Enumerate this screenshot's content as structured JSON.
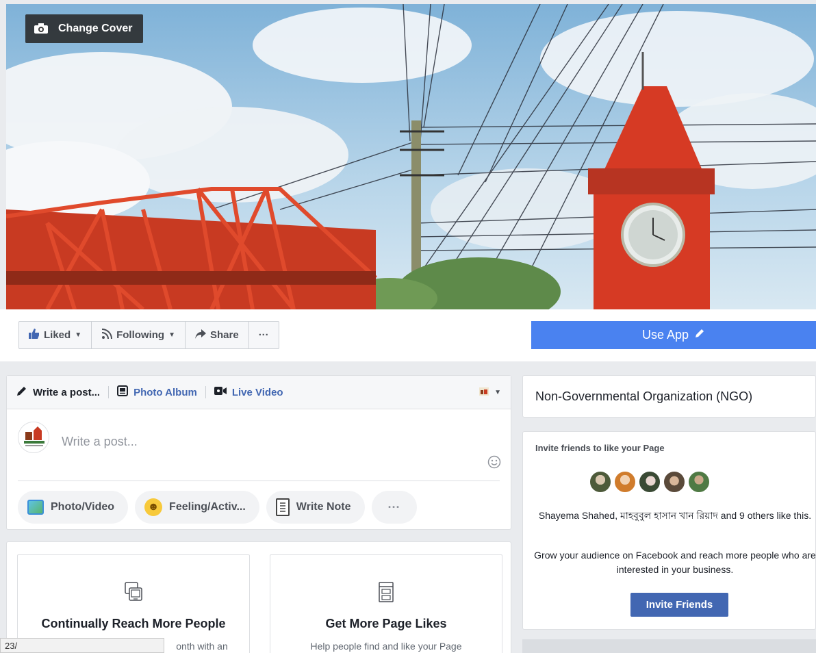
{
  "cover": {
    "change_cover_label": "Change Cover"
  },
  "actions": {
    "liked_label": "Liked",
    "following_label": "Following",
    "share_label": "Share",
    "more_label": "···",
    "use_app_label": "Use App"
  },
  "composer": {
    "tabs": {
      "write_post": "Write a post...",
      "photo_album": "Photo Album",
      "live_video": "Live Video"
    },
    "placeholder": "Write a post...",
    "pills": {
      "photo_video": "Photo/Video",
      "feeling": "Feeling/Activ...",
      "write_note": "Write Note",
      "more": "···"
    }
  },
  "promo": {
    "card1": {
      "title": "Continually Reach More People",
      "desc": "onth with an"
    },
    "card2": {
      "title": "Get More Page Likes",
      "desc": "Help people find and like your Page"
    }
  },
  "sidebar": {
    "category": "Non-Governmental Organization (NGO)",
    "invite_title": "Invite friends to like your Page",
    "likes_text": "Shayema Shahed, মাহবুবুল হাসান খান রিয়াদ and 9 others like this.",
    "grow_text": "Grow your audience on Facebook and reach more people who are interested in your business.",
    "invite_button": "Invite Friends"
  },
  "status_bar": {
    "url": "23/"
  },
  "colors": {
    "facebook_blue": "#4267b2",
    "use_app_blue": "#4a82f0",
    "background": "#e9ebee"
  }
}
